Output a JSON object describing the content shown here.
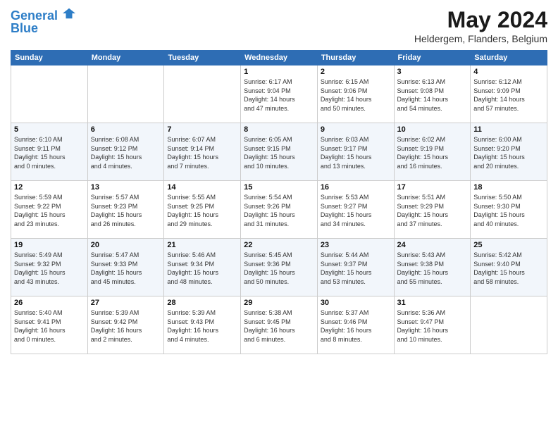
{
  "header": {
    "logo_line1": "General",
    "logo_line2": "Blue",
    "month_year": "May 2024",
    "location": "Heldergem, Flanders, Belgium"
  },
  "days_of_week": [
    "Sunday",
    "Monday",
    "Tuesday",
    "Wednesday",
    "Thursday",
    "Friday",
    "Saturday"
  ],
  "weeks": [
    [
      {
        "day": "",
        "info": ""
      },
      {
        "day": "",
        "info": ""
      },
      {
        "day": "",
        "info": ""
      },
      {
        "day": "1",
        "info": "Sunrise: 6:17 AM\nSunset: 9:04 PM\nDaylight: 14 hours\nand 47 minutes."
      },
      {
        "day": "2",
        "info": "Sunrise: 6:15 AM\nSunset: 9:06 PM\nDaylight: 14 hours\nand 50 minutes."
      },
      {
        "day": "3",
        "info": "Sunrise: 6:13 AM\nSunset: 9:08 PM\nDaylight: 14 hours\nand 54 minutes."
      },
      {
        "day": "4",
        "info": "Sunrise: 6:12 AM\nSunset: 9:09 PM\nDaylight: 14 hours\nand 57 minutes."
      }
    ],
    [
      {
        "day": "5",
        "info": "Sunrise: 6:10 AM\nSunset: 9:11 PM\nDaylight: 15 hours\nand 0 minutes."
      },
      {
        "day": "6",
        "info": "Sunrise: 6:08 AM\nSunset: 9:12 PM\nDaylight: 15 hours\nand 4 minutes."
      },
      {
        "day": "7",
        "info": "Sunrise: 6:07 AM\nSunset: 9:14 PM\nDaylight: 15 hours\nand 7 minutes."
      },
      {
        "day": "8",
        "info": "Sunrise: 6:05 AM\nSunset: 9:15 PM\nDaylight: 15 hours\nand 10 minutes."
      },
      {
        "day": "9",
        "info": "Sunrise: 6:03 AM\nSunset: 9:17 PM\nDaylight: 15 hours\nand 13 minutes."
      },
      {
        "day": "10",
        "info": "Sunrise: 6:02 AM\nSunset: 9:19 PM\nDaylight: 15 hours\nand 16 minutes."
      },
      {
        "day": "11",
        "info": "Sunrise: 6:00 AM\nSunset: 9:20 PM\nDaylight: 15 hours\nand 20 minutes."
      }
    ],
    [
      {
        "day": "12",
        "info": "Sunrise: 5:59 AM\nSunset: 9:22 PM\nDaylight: 15 hours\nand 23 minutes."
      },
      {
        "day": "13",
        "info": "Sunrise: 5:57 AM\nSunset: 9:23 PM\nDaylight: 15 hours\nand 26 minutes."
      },
      {
        "day": "14",
        "info": "Sunrise: 5:55 AM\nSunset: 9:25 PM\nDaylight: 15 hours\nand 29 minutes."
      },
      {
        "day": "15",
        "info": "Sunrise: 5:54 AM\nSunset: 9:26 PM\nDaylight: 15 hours\nand 31 minutes."
      },
      {
        "day": "16",
        "info": "Sunrise: 5:53 AM\nSunset: 9:27 PM\nDaylight: 15 hours\nand 34 minutes."
      },
      {
        "day": "17",
        "info": "Sunrise: 5:51 AM\nSunset: 9:29 PM\nDaylight: 15 hours\nand 37 minutes."
      },
      {
        "day": "18",
        "info": "Sunrise: 5:50 AM\nSunset: 9:30 PM\nDaylight: 15 hours\nand 40 minutes."
      }
    ],
    [
      {
        "day": "19",
        "info": "Sunrise: 5:49 AM\nSunset: 9:32 PM\nDaylight: 15 hours\nand 43 minutes."
      },
      {
        "day": "20",
        "info": "Sunrise: 5:47 AM\nSunset: 9:33 PM\nDaylight: 15 hours\nand 45 minutes."
      },
      {
        "day": "21",
        "info": "Sunrise: 5:46 AM\nSunset: 9:34 PM\nDaylight: 15 hours\nand 48 minutes."
      },
      {
        "day": "22",
        "info": "Sunrise: 5:45 AM\nSunset: 9:36 PM\nDaylight: 15 hours\nand 50 minutes."
      },
      {
        "day": "23",
        "info": "Sunrise: 5:44 AM\nSunset: 9:37 PM\nDaylight: 15 hours\nand 53 minutes."
      },
      {
        "day": "24",
        "info": "Sunrise: 5:43 AM\nSunset: 9:38 PM\nDaylight: 15 hours\nand 55 minutes."
      },
      {
        "day": "25",
        "info": "Sunrise: 5:42 AM\nSunset: 9:40 PM\nDaylight: 15 hours\nand 58 minutes."
      }
    ],
    [
      {
        "day": "26",
        "info": "Sunrise: 5:40 AM\nSunset: 9:41 PM\nDaylight: 16 hours\nand 0 minutes."
      },
      {
        "day": "27",
        "info": "Sunrise: 5:39 AM\nSunset: 9:42 PM\nDaylight: 16 hours\nand 2 minutes."
      },
      {
        "day": "28",
        "info": "Sunrise: 5:39 AM\nSunset: 9:43 PM\nDaylight: 16 hours\nand 4 minutes."
      },
      {
        "day": "29",
        "info": "Sunrise: 5:38 AM\nSunset: 9:45 PM\nDaylight: 16 hours\nand 6 minutes."
      },
      {
        "day": "30",
        "info": "Sunrise: 5:37 AM\nSunset: 9:46 PM\nDaylight: 16 hours\nand 8 minutes."
      },
      {
        "day": "31",
        "info": "Sunrise: 5:36 AM\nSunset: 9:47 PM\nDaylight: 16 hours\nand 10 minutes."
      },
      {
        "day": "",
        "info": ""
      }
    ]
  ]
}
